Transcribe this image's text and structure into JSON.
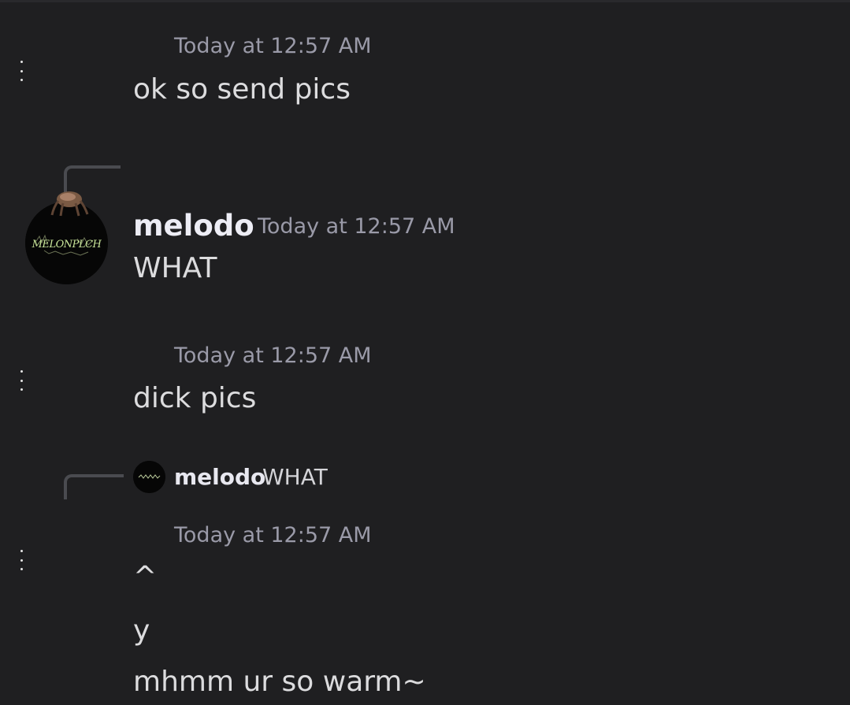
{
  "messages": [
    {
      "timestamp": "Today at 12:57 AM",
      "text": "ok so send pics"
    },
    {
      "author": "melodo",
      "timestamp": "Today at 12:57 AM",
      "text": "WHAT",
      "avatar_text": "MELONPLCH"
    },
    {
      "timestamp": "Today at 12:57 AM",
      "text": "dick pics"
    },
    {
      "reply": {
        "author": "melodo",
        "text": "WHAT"
      },
      "timestamp": "Today at 12:57 AM",
      "lines": [
        "^",
        "y",
        "mhmm ur so warm~"
      ]
    }
  ],
  "colors": {
    "background": "#1f1f21",
    "timestamp": "#9a9aa8",
    "text": "#dcdcde",
    "username": "#ededf5"
  }
}
